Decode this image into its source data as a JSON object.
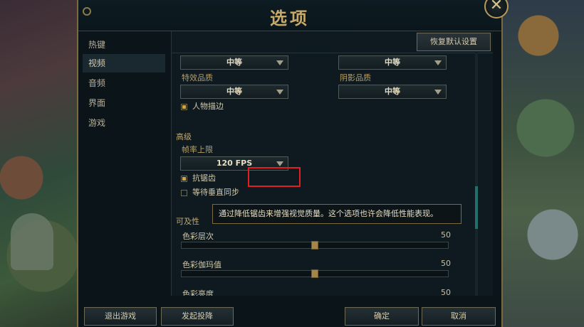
{
  "window": {
    "title": "选项",
    "close_glyph": "✕"
  },
  "sidebar": {
    "items": [
      {
        "label": "热键",
        "active": false
      },
      {
        "label": "视频",
        "active": true
      },
      {
        "label": "音频",
        "active": false
      },
      {
        "label": "界面",
        "active": false
      },
      {
        "label": "游戏",
        "active": false
      }
    ]
  },
  "content": {
    "reset_label": "恢复默认设置",
    "top_selects": [
      "中等",
      "中等"
    ],
    "effects_label": "特效品质",
    "effects_value": "中等",
    "shadow_label": "阴影品质",
    "shadow_value": "中等",
    "character_outline": {
      "label": "人物描边",
      "checked": true
    },
    "advanced_section": "高级",
    "framerate_label": "帧率上限",
    "framerate_value": "120 FPS",
    "antialiasing": {
      "label": "抗锯齿",
      "checked": true
    },
    "vsync": {
      "label": "等待垂直同步",
      "checked": false
    },
    "accessibility_section": "可及性",
    "sliders": [
      {
        "label": "色彩层次",
        "value": "50"
      },
      {
        "label": "色彩伽玛值",
        "value": "50"
      },
      {
        "label": "色彩亮度",
        "value": "50"
      }
    ]
  },
  "tooltip": {
    "text": "通过降低锯齿来增强视觉质量。这个选项也许会降低性能表现。"
  },
  "footer": {
    "quit_label": "退出游戏",
    "surrender_label": "发起投降",
    "ok_label": "确定",
    "cancel_label": "取消"
  },
  "colors": {
    "accent": "#c8a96a",
    "highlight": "#e02020",
    "scroll_thumb": "#1f6f6a"
  }
}
